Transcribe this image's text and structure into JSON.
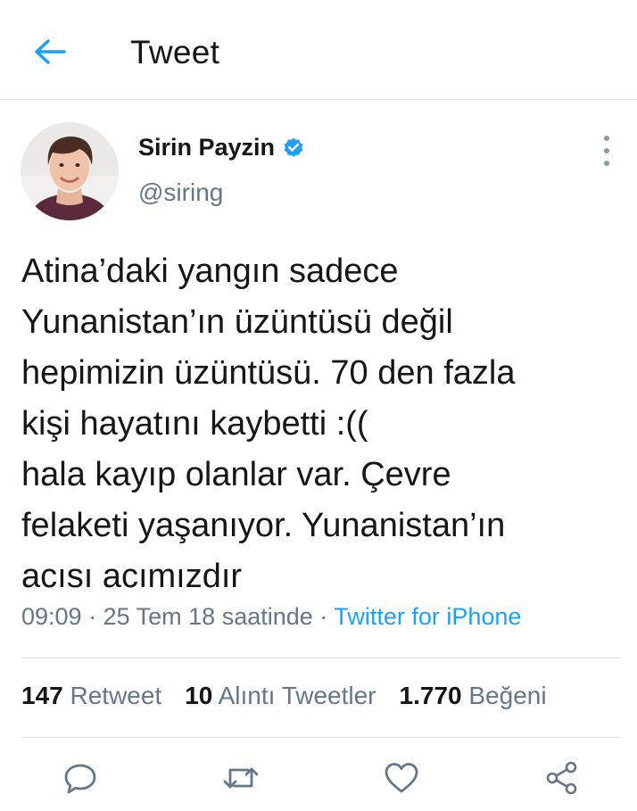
{
  "header": {
    "back_icon": "arrow-left-icon",
    "title": "Tweet"
  },
  "tweet": {
    "display_name": "Sirin Payzin",
    "handle": "@siring",
    "verified": true,
    "text": "Atina’daki yangın sadece\nYunanistan’ın üzüntüsü değil\nhepimizin üzüntüsü. 70 den fazla\nkişi hayatını kaybetti :((\nhala kayıp olanlar var. Çevre\nfelaketi yaşanıyor. Yunanistan’ın\nacısı acımızdır",
    "time": "09:09",
    "date": "25 Tem 18 saatinde",
    "separator": "·",
    "source": "Twitter for iPhone"
  },
  "stats": {
    "retweets_count": "147",
    "retweets_label": "Retweet",
    "quotes_count": "10",
    "quotes_label": "Alıntı Tweetler",
    "likes_count": "1.770",
    "likes_label": "Beğeni"
  },
  "colors": {
    "accent": "#1da1f2",
    "text": "#14171a",
    "secondary": "#657786"
  },
  "actions": [
    "reply-icon",
    "retweet-icon",
    "like-icon",
    "share-icon"
  ]
}
